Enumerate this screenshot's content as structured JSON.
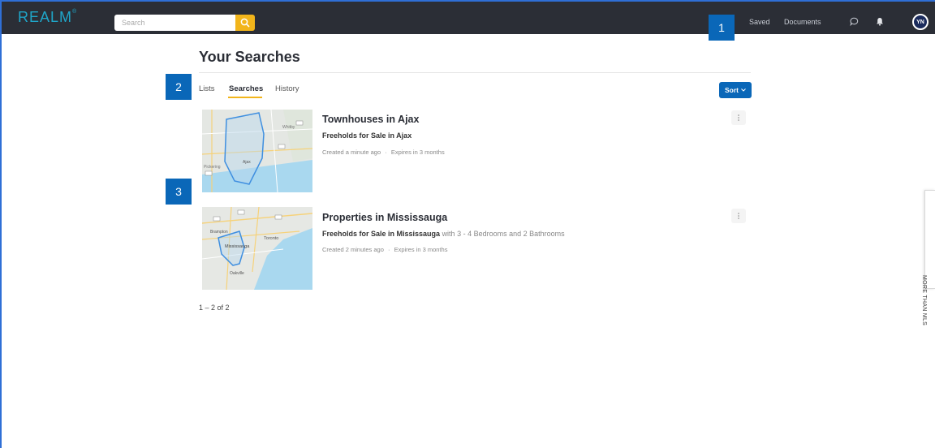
{
  "header": {
    "logo": "REALM",
    "search": {
      "placeholder": "Search"
    },
    "nav": {
      "saved": "Saved",
      "documents": "Documents"
    },
    "avatar_initials": "YN",
    "colors": {
      "bar": "#2b2e36",
      "accent": "#f2b51b",
      "logo": "#1fa6c9"
    }
  },
  "markers": [
    "1",
    "2",
    "3"
  ],
  "page": {
    "title": "Your Searches",
    "tabs": [
      {
        "label": "Lists",
        "active": false
      },
      {
        "label": "Searches",
        "active": true
      },
      {
        "label": "History",
        "active": false
      }
    ],
    "sort_label": "Sort",
    "searches": [
      {
        "title": "Townhouses in Ajax",
        "subtitle_bold": "Freeholds for Sale in Ajax",
        "subtitle_rest": "",
        "created": "Created a minute ago",
        "expires": "Expires in 3 months",
        "map_labels": [
          "Whitby",
          "Ajax",
          "Pickering"
        ]
      },
      {
        "title": "Properties in Mississauga",
        "subtitle_bold": "Freeholds for Sale in Mississauga",
        "subtitle_rest": "with 3 - 4 Bedrooms and 2 Bathrooms",
        "created": "Created 2 minutes ago",
        "expires": "Expires in 3 months",
        "map_labels": [
          "Brampton",
          "Toronto",
          "Mississauga",
          "Oakville"
        ]
      }
    ],
    "pagination": "1 – 2 of 2"
  },
  "side_tab": {
    "label": "MORE THAN MLS"
  },
  "icons": {
    "search": "search-icon",
    "chat": "chat-icon",
    "bell": "bell-icon",
    "more": "more-vertical-icon",
    "chevron": "chevron-down-icon"
  }
}
